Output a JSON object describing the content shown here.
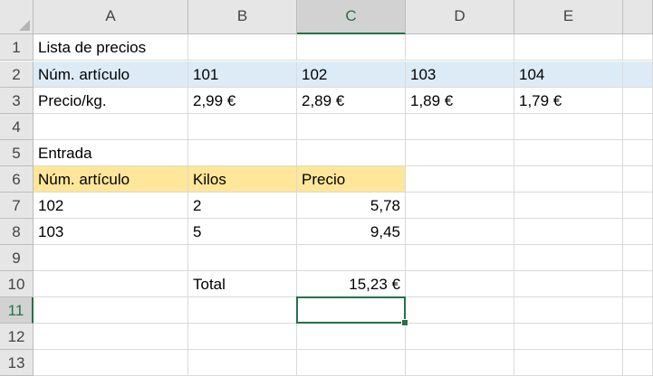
{
  "columns": [
    "A",
    "B",
    "C",
    "D",
    "E"
  ],
  "rows": [
    "1",
    "2",
    "3",
    "4",
    "5",
    "6",
    "7",
    "8",
    "9",
    "10",
    "11",
    "12",
    "13"
  ],
  "selected_cell": "C11",
  "colors": {
    "header_fill": "#e6e6e6",
    "selected_accent": "#217346",
    "row2_fill": "#ddebf7",
    "row6_fill": "#ffe699"
  },
  "cells": {
    "A1": "Lista de precios",
    "A2": "Núm. artículo",
    "B2": "101",
    "C2": "102",
    "D2": "103",
    "E2": "104",
    "A3": "Precio/kg.",
    "B3": "2,99 €",
    "C3": "2,89 €",
    "D3": "1,89 €",
    "E3": "1,79 €",
    "A5": "Entrada",
    "A6": "Núm. artículo",
    "B6": "Kilos",
    "C6": "Precio",
    "A7": "102",
    "B7": "2",
    "C7": "5,78",
    "A8": "103",
    "B8": "5",
    "C8": "9,45",
    "B10": "Total",
    "C10": "15,23 €"
  }
}
